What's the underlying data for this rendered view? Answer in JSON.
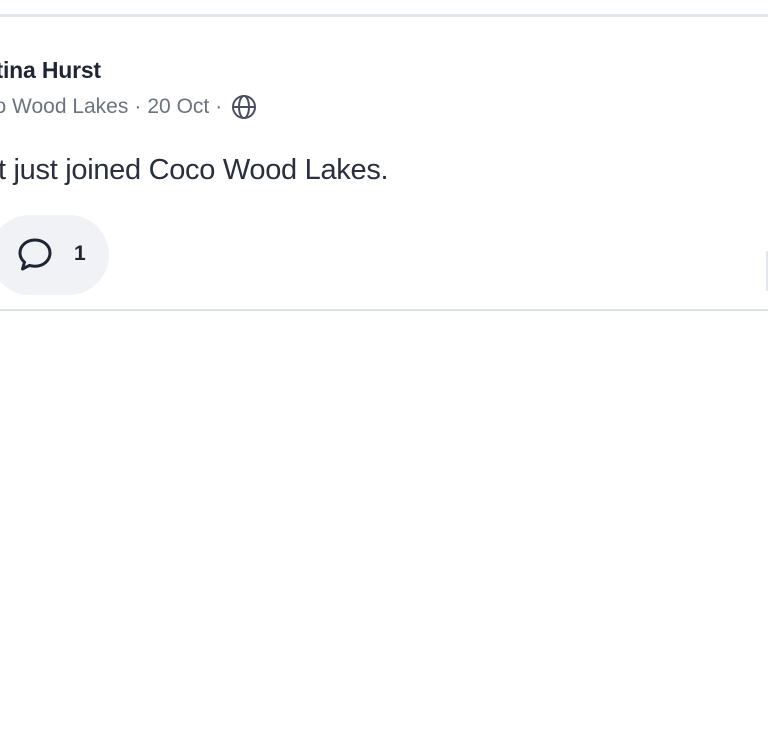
{
  "post": {
    "author_name": "ristina Hurst",
    "group_name": "co Wood Lakes",
    "separator": "·",
    "date": "20 Oct",
    "visibility_icon": "globe-icon",
    "body_text": "Hurst just joined Coco Wood Lakes.",
    "comment_icon": "comment-bubble-icon",
    "comment_count": "1"
  },
  "colors": {
    "text_primary": "#1f2533",
    "text_secondary": "#6b7280",
    "pill_background": "#f1f2f6",
    "divider": "#dde1ea"
  }
}
